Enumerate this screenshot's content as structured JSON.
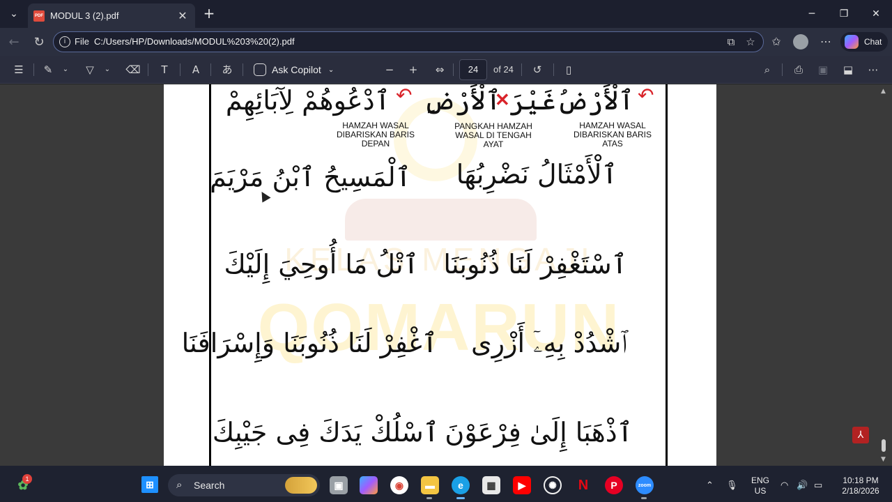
{
  "browser": {
    "tab_title": "MODUL 3 (2).pdf",
    "tab_icon_text": "PDF",
    "address_label": "File",
    "url": "C:/Users/HP/Downloads/MODUL%203%20(2).pdf",
    "chat_label": "Chat"
  },
  "pdf_toolbar": {
    "ask_copilot": "Ask Copilot",
    "current_page": "24",
    "page_count": "of 24"
  },
  "document": {
    "captions": [
      "HAMZAH WASAL DIBARISKAN BARIS DEPAN",
      "PANGKAH HAMZAH WASAL DI TENGAH AYAT",
      "HAMZAH WASAL DIBARISKAN BARIS ATAS"
    ],
    "line1_left": "ٱدْعُوهُمْ لِآبَائِهِمْ",
    "line1_mid": "غَيْرَ ٱلْأَرْضِ",
    "line1_right": "ٱلْأَرْضُ",
    "line2_left": "ٱلْمَسِيحُ ٱبْنُ مَرْيَمَ",
    "line2_right": "ٱلْأَمْثَالُ نَضْرِبُهَا",
    "line3_left": "ٱتْلُ مَا أُوحِيَ إِلَيْكَ",
    "line3_right": "ٱسْتَغْفِرْ لَنَا ذُنُوبَنَا",
    "line4_left": "ٱغْفِرْ لَنَا ذُنُوبَنَا وَإِسْرَافَنَا",
    "line4_right": "ٱشْدُدْ بِهِۦٓ أَزْرِى",
    "line5_left": "ٱسْلُكْ يَدَكَ فِى جَيْبِكَ",
    "line5_right": "ٱذْهَبَا إِلَىٰ فِرْعَوْنَ",
    "watermark_top": "KELAS MENGAJI",
    "watermark_main": "QOMARUN",
    "cross_mark": "✕"
  },
  "taskbar": {
    "search_label": "Search",
    "notification_count": "1",
    "zoom_label": "zoom",
    "lang_line1": "ENG",
    "lang_line2": "US",
    "time": "10:18 PM",
    "date": "2/18/2026"
  },
  "colors": {
    "accent_red": "#d9232a",
    "watermark_yellow": "#fad75a"
  }
}
